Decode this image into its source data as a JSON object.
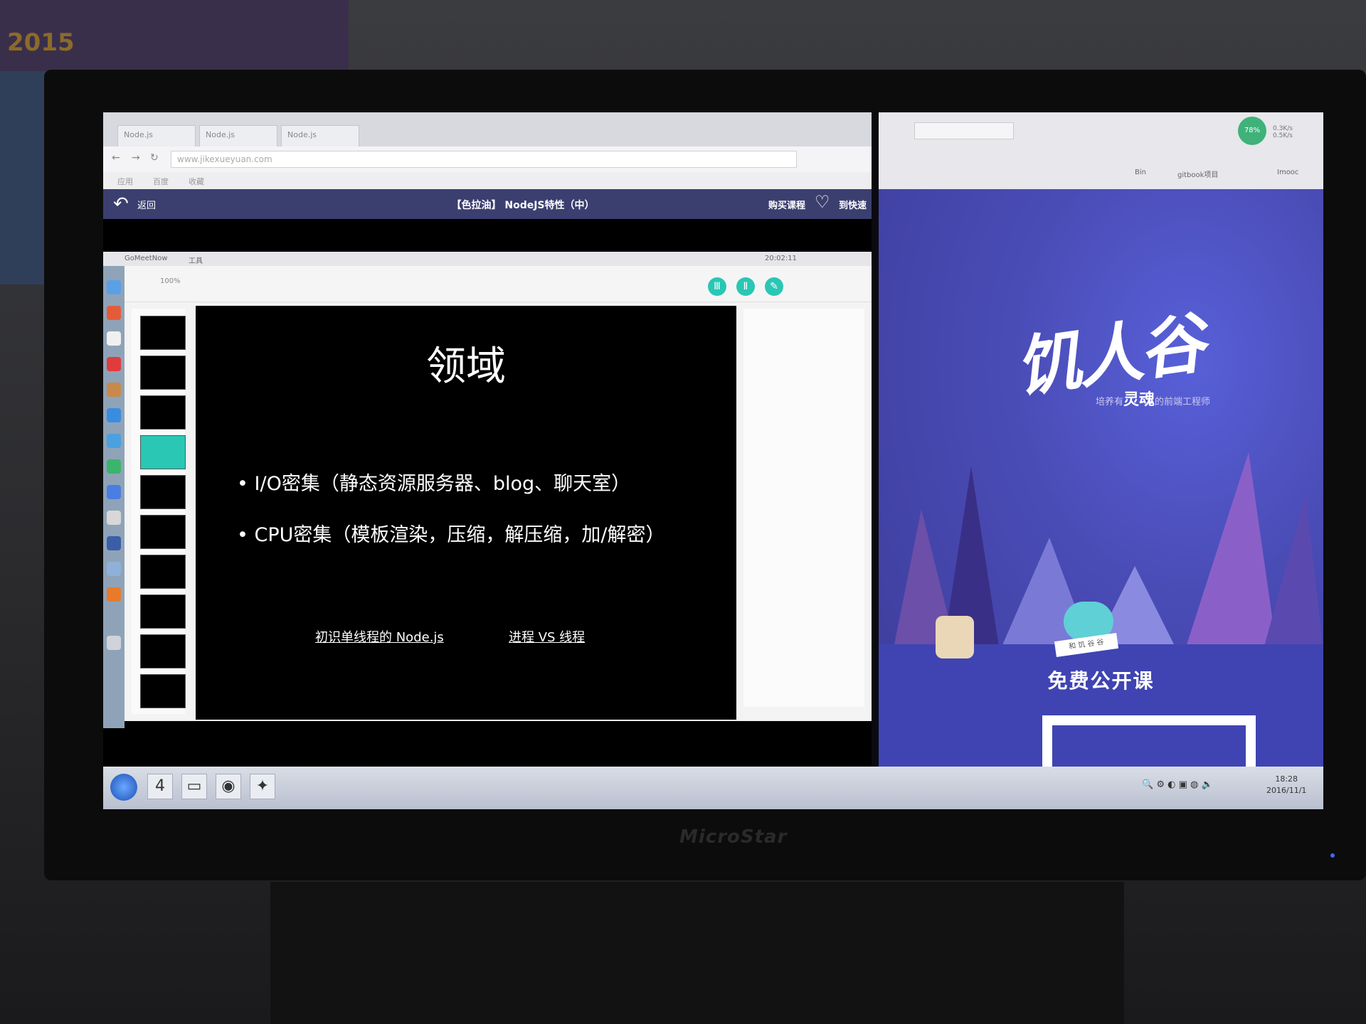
{
  "poster": {
    "year_text": "2015"
  },
  "monitor": {
    "brand": "MicroStar"
  },
  "left_browser": {
    "tabs": [
      "Node.js",
      "Node.js",
      "Node.js"
    ],
    "url": "www.jikexueyuan.com",
    "bookmarks": [
      "应用",
      "百度",
      "收藏"
    ],
    "lesson_bar": {
      "back_label": "返回",
      "title": "【色拉油】 NodeJS特性（中）",
      "buy_label": "购买课程",
      "quick_label": "到快速"
    }
  },
  "remote": {
    "menu": [
      "GoMeetNow",
      "工具"
    ],
    "status_time": "20:02:11",
    "zoom": "100%"
  },
  "slide": {
    "title": "领域",
    "bullets": [
      "I/O密集（静态资源服务器、blog、聊天室）",
      "CPU密集（模板渲染，压缩，解压缩，加/解密）"
    ],
    "links": [
      "初识单线程的 Node.js",
      "进程 VS 线程"
    ]
  },
  "right_browser": {
    "bookmarks": [
      "Bin",
      "gitbook项目",
      "Imooc"
    ],
    "net_percent": "78%",
    "speed_up": "0.3K/s",
    "speed_down": "0.5K/s",
    "logo": "饥人谷",
    "slogan_prefix": "培养有",
    "slogan_soul": "灵魂",
    "slogan_suffix": "的前端工程师",
    "mascot_sign": "和 饥 谷 谷",
    "free_course": "免费公开课"
  },
  "taskbar": {
    "item_number": "4",
    "clock_time": "18:28",
    "clock_date": "2016/11/1"
  },
  "colors": {
    "lesson_bar": "#3b3f6f",
    "hero_bg": "#4a4cb6",
    "keynote_accent": "#29c7b4"
  }
}
